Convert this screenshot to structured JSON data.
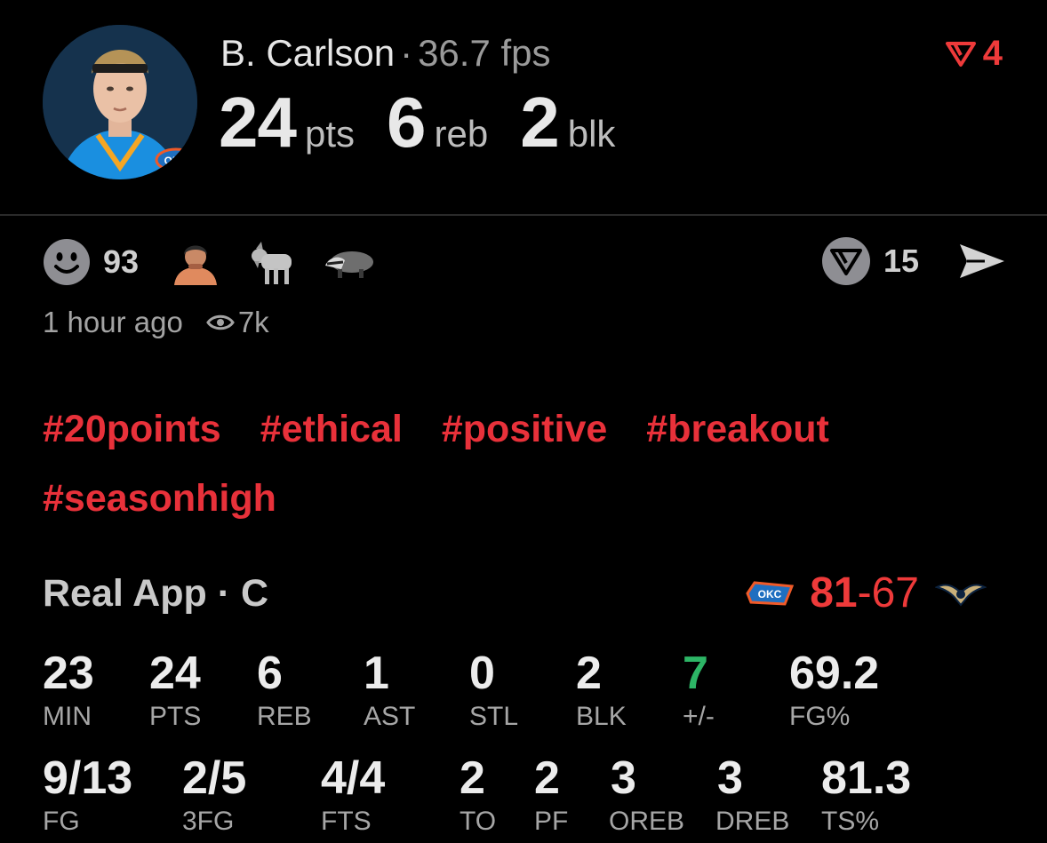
{
  "player": {
    "name": "B. Carlson",
    "separator": "·",
    "fps": "36.7 fps"
  },
  "headline": {
    "pts_value": "24",
    "pts_unit": "pts",
    "reb_value": "6",
    "reb_unit": "reb",
    "blk_value": "2",
    "blk_unit": "blk"
  },
  "badge": {
    "icon": "red-v-logo-icon",
    "count": "4"
  },
  "reactions": {
    "smiley_count": "93",
    "emojis": [
      "person-emoji",
      "goat-emoji",
      "badger-emoji"
    ]
  },
  "actions": {
    "v_count": "15",
    "share_icon": "send-icon"
  },
  "meta": {
    "time": "1 hour ago",
    "views": "7k"
  },
  "tags": [
    "#20points",
    "#ethical",
    "#positive",
    "#breakout",
    "#seasonhigh"
  ],
  "game": {
    "title": "Real App · C",
    "home_score": "81",
    "dash": "-",
    "away_score": "67",
    "home_team_icon": "okc-logo-icon",
    "away_team_icon": "pelicans-logo-icon"
  },
  "stats_row1": [
    {
      "value": "23",
      "label": "MIN"
    },
    {
      "value": "24",
      "label": "PTS"
    },
    {
      "value": "6",
      "label": "REB"
    },
    {
      "value": "1",
      "label": "AST"
    },
    {
      "value": "0",
      "label": "STL"
    },
    {
      "value": "2",
      "label": "BLK"
    },
    {
      "value": "7",
      "label": "+/-"
    },
    {
      "value": "69.2",
      "label": "FG%"
    }
  ],
  "stats_row2": [
    {
      "value": "9/13",
      "label": "FG"
    },
    {
      "value": "2/5",
      "label": "3FG"
    },
    {
      "value": "4/4",
      "label": "FTS"
    },
    {
      "value": "2",
      "label": "TO"
    },
    {
      "value": "2",
      "label": "PF"
    },
    {
      "value": "3",
      "label": "OREB"
    },
    {
      "value": "3",
      "label": "DREB"
    },
    {
      "value": "81.3",
      "label": "TS%"
    }
  ],
  "colors": {
    "accent_red": "#e8313a",
    "positive_green": "#2db566",
    "background": "#000000"
  }
}
